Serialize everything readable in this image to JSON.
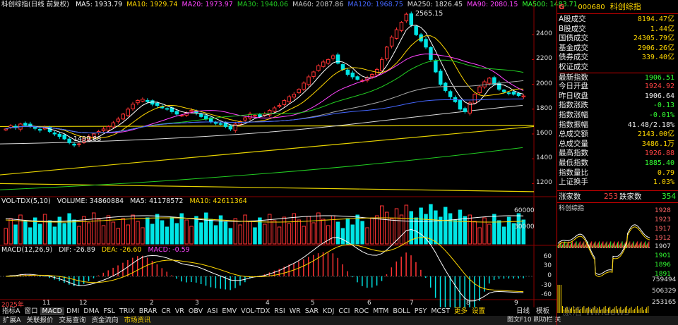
{
  "main_header": {
    "title": "科创综指(日线 前复权)",
    "ma": [
      {
        "label": "MA5: 1933.79",
        "color": "#ffffff"
      },
      {
        "label": "MA10: 1929.74",
        "color": "#ffd700"
      },
      {
        "label": "MA20: 1973.97",
        "color": "#ff44ff"
      },
      {
        "label": "MA30: 1940.06",
        "color": "#22cc22"
      },
      {
        "label": "MA60: 2087.86",
        "color": "#cccccc"
      },
      {
        "label": "MA120: 1968.75",
        "color": "#4466ff"
      },
      {
        "label": "MA250: 1826.45",
        "color": "#dddddd"
      },
      {
        "label": "MA90: 2080.15",
        "color": "#ff44ff"
      },
      {
        "label": "MA500: 1483.71",
        "color": "#33ff33"
      }
    ]
  },
  "price_axis": [
    "2400",
    "2200",
    "2000",
    "1800",
    "1600",
    "1400",
    "1200"
  ],
  "annotations": {
    "high": "2565.15",
    "low": "1499.88"
  },
  "volume_header": {
    "title": "VOL-TDX(5,10)",
    "volume": "VOLUME: 34860884",
    "ma5": "MA5: 41178572",
    "ma10": "MA10: 42611364"
  },
  "volume_axis": [
    "60000",
    "30000"
  ],
  "macd_header": {
    "title": "MACD(12,26,9)",
    "dif": "DIF: -26.89",
    "dea": "DEA: -26.60",
    "macd": "MACD: -0.59"
  },
  "macd_axis": [
    "60",
    "30",
    "0",
    "-30",
    "-60"
  ],
  "time_axis": [
    "2025年",
    "11",
    "12",
    "2",
    "3",
    "4",
    "5",
    "6",
    "7",
    "8",
    "9"
  ],
  "tabs": [
    "指标A",
    "窗口",
    "MACD",
    "DMI",
    "DMA",
    "FSL",
    "TRIX",
    "BRAR",
    "CR",
    "VR",
    "OBV",
    "ASI",
    "EMV",
    "VOL-TDX",
    "RSI",
    "WR",
    "SAR",
    "KDJ",
    "CCI",
    "ROC",
    "MTM",
    "BOLL",
    "PSY",
    "MCST",
    "更多",
    "设置"
  ],
  "tab_right": [
    "日线",
    "模板"
  ],
  "bottom_bar": [
    "扩展A",
    "关联报价",
    "交易查询",
    "资金流向",
    "市场资讯"
  ],
  "watermark": "激活 Windows",
  "bottom_right_hint": "图文F10 刷功栏 关",
  "right_panel": {
    "code": "000680",
    "name": "科创综指",
    "g": "G",
    "rows": [
      {
        "label": "A股成交",
        "value": "8194.47亿",
        "color": "#ffd700"
      },
      {
        "label": "B股成交",
        "value": "1.44亿",
        "color": "#ffd700"
      },
      {
        "label": "国债成交",
        "value": "24305.79亿",
        "color": "#ffd700"
      },
      {
        "label": "基金成交",
        "value": "2906.26亿",
        "color": "#ffd700"
      },
      {
        "label": "债券成交",
        "value": "339.40亿",
        "color": "#ffd700"
      },
      {
        "label": "权证成交",
        "value": "",
        "color": "#ffd700"
      },
      {
        "label": "最新指数",
        "value": "1906.51",
        "color": "#33ff33"
      },
      {
        "label": "今日开盘",
        "value": "1924.92",
        "color": "#ff4444"
      },
      {
        "label": "昨日收盘",
        "value": "1906.64",
        "color": "#eeeeee"
      },
      {
        "label": "指数涨跌",
        "value": "-0.13",
        "color": "#33ff33"
      },
      {
        "label": "指数涨幅",
        "value": "-0.01%",
        "color": "#33ff33"
      },
      {
        "label": "指数振幅",
        "value": "41.48/2.18%",
        "color": "#eeeeee"
      },
      {
        "label": "总成交额",
        "value": "2143.00亿",
        "color": "#ffd700"
      },
      {
        "label": "总成交量",
        "value": "3486.1万",
        "color": "#ffd700"
      },
      {
        "label": "最高指数",
        "value": "1926.88",
        "color": "#ff4444"
      },
      {
        "label": "最低指数",
        "value": "1885.40",
        "color": "#33ff33"
      },
      {
        "label": "指数量比",
        "value": "0.79",
        "color": "#ffd700"
      },
      {
        "label": "上证换手",
        "value": "1.03%",
        "color": "#ffd700"
      }
    ],
    "rise_label": "涨家数",
    "rise_value": "253",
    "fall_label": "跌家数",
    "fall_value": "354",
    "mini_title": "科创综指",
    "mini_axis": [
      "1928",
      "1923",
      "1917",
      "1912",
      "1907",
      "1901",
      "1896",
      "1891"
    ],
    "mini_vol_axis": [
      "759494",
      "506329",
      "253165"
    ]
  },
  "chart_data": {
    "type": "candlestick",
    "title": "科创综指(日线 前复权)",
    "ylim": [
      1100,
      2600
    ],
    "high": 2565.15,
    "low": 1499.88,
    "closes": [
      1640,
      1665,
      1650,
      1680,
      1670,
      1660,
      1645,
      1630,
      1650,
      1620,
      1600,
      1580,
      1560,
      1530,
      1510,
      1520,
      1560,
      1580,
      1600,
      1620,
      1640,
      1660,
      1690,
      1720,
      1760,
      1800,
      1840,
      1870,
      1880,
      1860,
      1840,
      1830,
      1810,
      1800,
      1780,
      1760,
      1750,
      1770,
      1790,
      1770,
      1740,
      1720,
      1700,
      1690,
      1680,
      1660,
      1640,
      1680,
      1700,
      1730,
      1760,
      1750,
      1740,
      1760,
      1790,
      1810,
      1830,
      1870,
      1900,
      1920,
      1960,
      2010,
      2060,
      2100,
      2150,
      2180,
      2200,
      2230,
      2170,
      2120,
      2080,
      2060,
      2040,
      2030,
      2050,
      2080,
      2120,
      2200,
      2300,
      2380,
      2440,
      2500,
      2565,
      2480,
      2400,
      2350,
      2300,
      2200,
      2100,
      2000,
      1950,
      1900,
      1860,
      1800,
      1780,
      1850,
      1920,
      1980,
      2020,
      2050,
      2000,
      1960,
      1940,
      1930,
      1920,
      1910,
      1906
    ]
  }
}
